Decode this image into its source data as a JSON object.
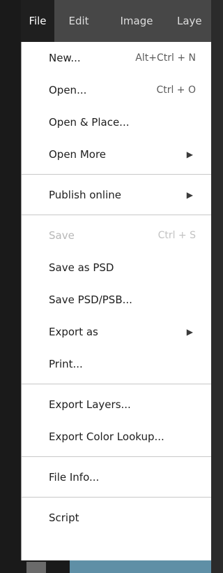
{
  "menubar": {
    "items": [
      {
        "label": "File"
      },
      {
        "label": "Edit"
      },
      {
        "label": "Image"
      },
      {
        "label": "Laye"
      }
    ]
  },
  "menu": {
    "new": {
      "label": "New...",
      "shortcut": "Alt+Ctrl + N"
    },
    "open": {
      "label": "Open...",
      "shortcut": "Ctrl + O"
    },
    "open_place": {
      "label": "Open & Place..."
    },
    "open_more": {
      "label": "Open More",
      "arrow": "▶"
    },
    "publish_online": {
      "label": "Publish online",
      "arrow": "▶"
    },
    "save": {
      "label": "Save",
      "shortcut": "Ctrl + S",
      "disabled": true
    },
    "save_psd": {
      "label": "Save as PSD"
    },
    "save_psd_psb": {
      "label": "Save PSD/PSB..."
    },
    "export_as": {
      "label": "Export as",
      "arrow": "▶"
    },
    "print": {
      "label": "Print..."
    },
    "export_layers": {
      "label": "Export Layers..."
    },
    "export_color_lookup": {
      "label": "Export Color Lookup..."
    },
    "file_info": {
      "label": "File Info..."
    },
    "script": {
      "label": "Script"
    }
  },
  "colors": {
    "menubar_bg": "#474747",
    "menubar_active_bg": "#1f1f1f",
    "menu_bg": "#ffffff",
    "disabled_text": "#b7b7b7"
  }
}
